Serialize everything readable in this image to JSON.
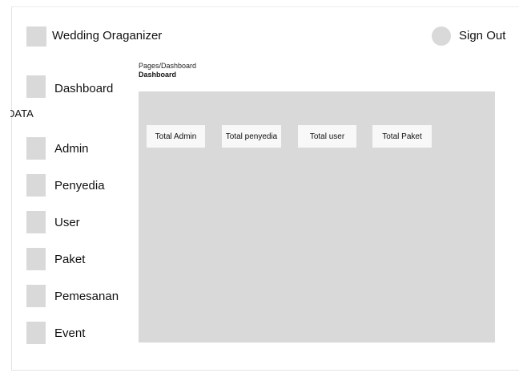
{
  "header": {
    "app_title": "Wedding Oraganizer",
    "sign_out_label": "Sign Out"
  },
  "sidebar": {
    "section_label": "DATA",
    "items": [
      {
        "label": "Dashboard",
        "icon": "dashboard-icon"
      },
      {
        "label": "Admin",
        "icon": "admin-icon"
      },
      {
        "label": "Penyedia",
        "icon": "penyedia-icon"
      },
      {
        "label": "User",
        "icon": "user-icon"
      },
      {
        "label": "Paket",
        "icon": "paket-icon"
      },
      {
        "label": "Pemesanan",
        "icon": "pemesanan-icon"
      },
      {
        "label": "Event",
        "icon": "event-icon"
      }
    ]
  },
  "breadcrumb": {
    "path": "Pages/Dashboard",
    "current": "Dashboard"
  },
  "stats": [
    {
      "label": "Total Admin"
    },
    {
      "label": "Total penyedia"
    },
    {
      "label": "Total user"
    },
    {
      "label": "Total Paket"
    }
  ],
  "colors": {
    "placeholder_gray": "#d9d9d9",
    "card_background": "#f8f8f8",
    "text": "#111111"
  }
}
